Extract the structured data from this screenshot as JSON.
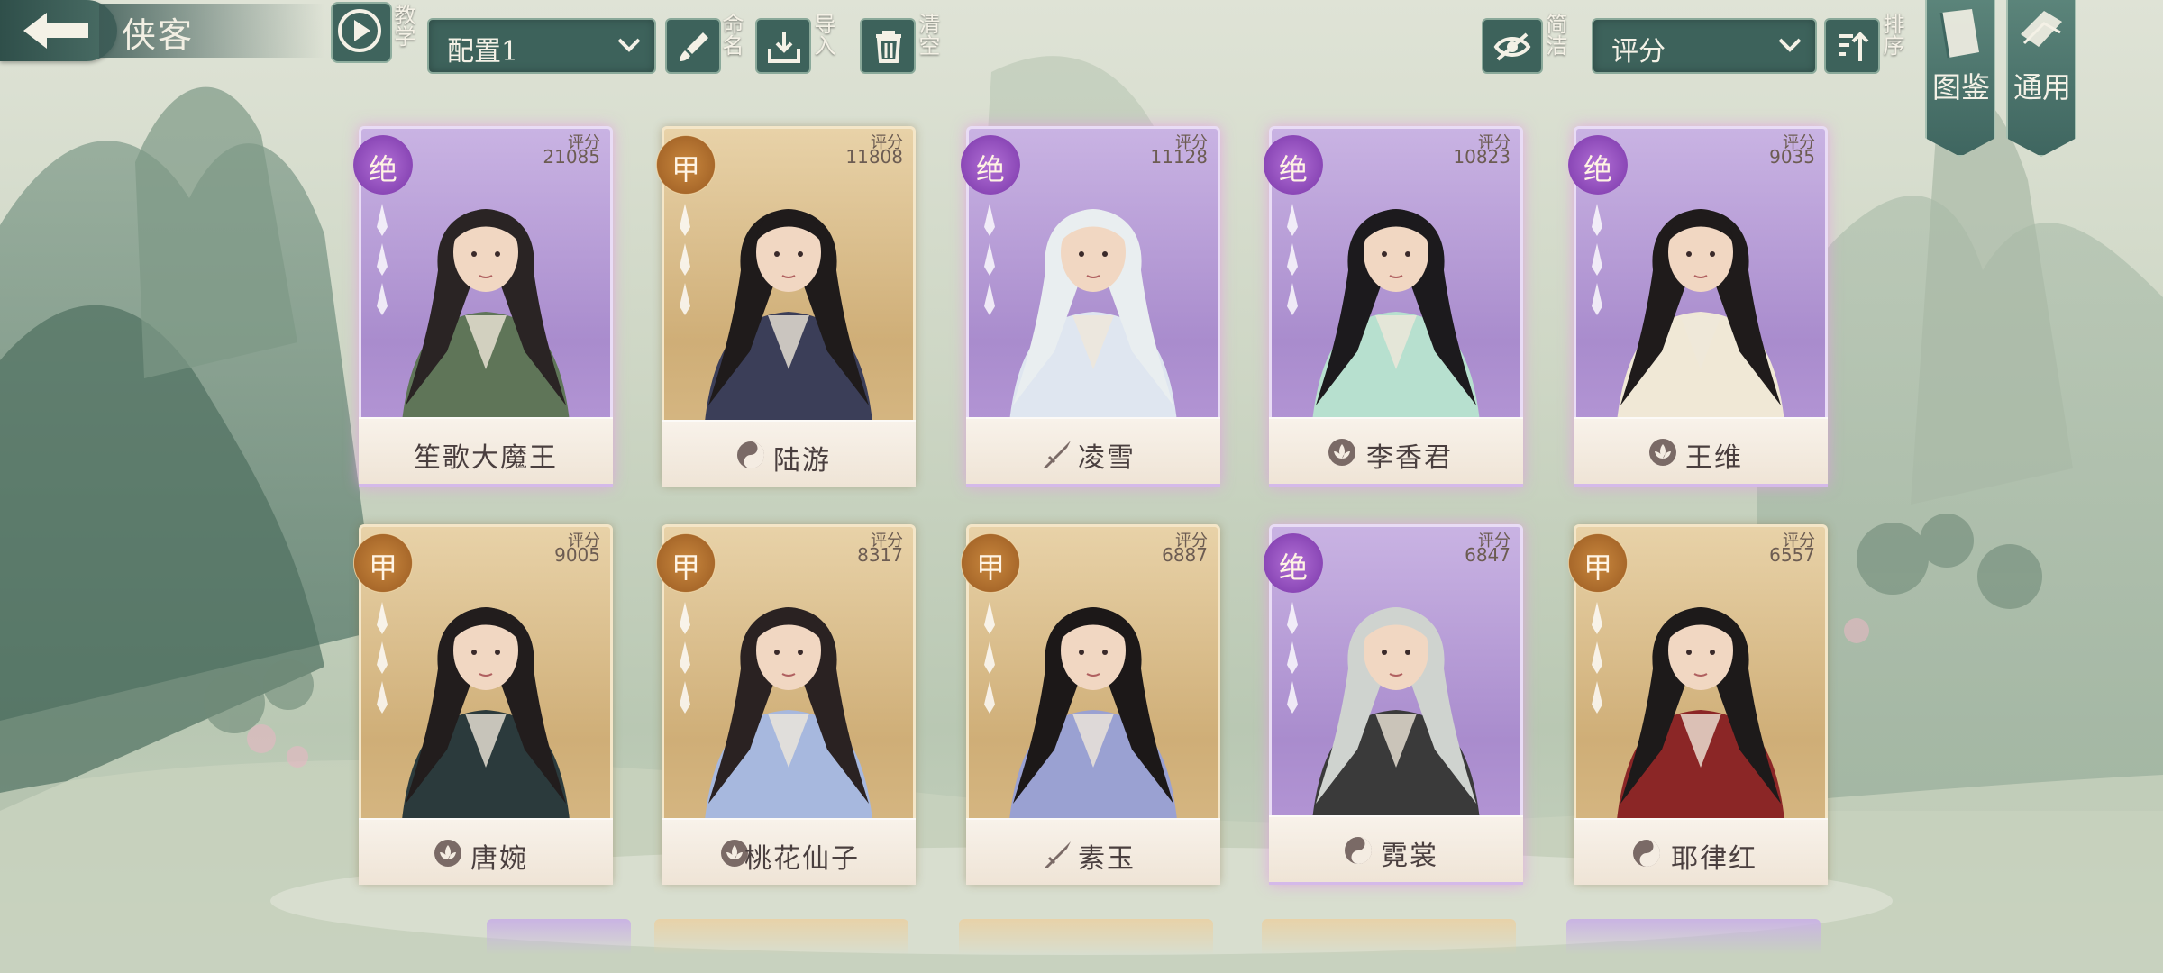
{
  "header": {
    "title": "侠客",
    "tutorial_label": "教学",
    "config_select": "配置1",
    "rename_label": "命名",
    "import_label": "导入",
    "clear_label": "清空",
    "concise_label": "简洁",
    "sort_select": "评分",
    "sort_label": "排序",
    "codex_label": "图鉴",
    "general_label": "通用"
  },
  "score_label": "评分",
  "colors": {
    "jue_purple": "#a98ccd",
    "jia_gold": "#cfae77",
    "toolbar_green": "#3d625b"
  },
  "cards": [
    {
      "name": "笙歌大魔王",
      "rank": "绝",
      "score": "21085",
      "faction": "",
      "faction_icon": "none"
    },
    {
      "name": "陆游",
      "rank": "甲",
      "score": "11808",
      "faction": "taiji",
      "faction_icon": "taiji-icon"
    },
    {
      "name": "凌雪",
      "rank": "绝",
      "score": "11128",
      "faction": "sword",
      "faction_icon": "sword-icon"
    },
    {
      "name": "李香君",
      "rank": "绝",
      "score": "10823",
      "faction": "lotus",
      "faction_icon": "lotus-icon"
    },
    {
      "name": "王维",
      "rank": "绝",
      "score": "9035",
      "faction": "lotus",
      "faction_icon": "lotus-icon"
    },
    {
      "name": "唐婉",
      "rank": "甲",
      "score": "9005",
      "faction": "lotus",
      "faction_icon": "lotus-icon"
    },
    {
      "name": "桃花仙子",
      "rank": "甲",
      "score": "8317",
      "faction": "lotus",
      "faction_icon": "lotus-icon"
    },
    {
      "name": "素玉",
      "rank": "甲",
      "score": "6887",
      "faction": "sword",
      "faction_icon": "sword-icon"
    },
    {
      "name": "霓裳",
      "rank": "绝",
      "score": "6847",
      "faction": "taiji",
      "faction_icon": "taiji-icon"
    },
    {
      "name": "耶律红",
      "rank": "甲",
      "score": "6557",
      "faction": "taiji",
      "faction_icon": "taiji-icon"
    }
  ]
}
